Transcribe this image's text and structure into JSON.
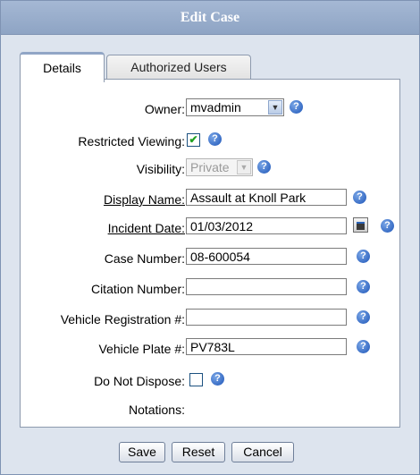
{
  "dialog": {
    "title": "Edit Case"
  },
  "tabs": {
    "details": "Details",
    "authorized_users": "Authorized Users"
  },
  "form": {
    "owner": {
      "label": "Owner:",
      "value": "mvadmin"
    },
    "restricted_viewing": {
      "label": "Restricted Viewing:",
      "checked": true
    },
    "visibility": {
      "label": "Visibility:",
      "value": "Private",
      "disabled": true
    },
    "display_name": {
      "label": "Display Name:",
      "value": "Assault at Knoll Park"
    },
    "incident_date": {
      "label": "Incident Date:",
      "value": "01/03/2012"
    },
    "case_number": {
      "label": "Case Number:",
      "value": "08-600054"
    },
    "citation_number": {
      "label": "Citation Number:",
      "value": ""
    },
    "vehicle_registration": {
      "label": "Vehicle Registration #:",
      "value": ""
    },
    "vehicle_plate": {
      "label": "Vehicle Plate #:",
      "value": "PV783L"
    },
    "do_not_dispose": {
      "label": "Do Not Dispose:",
      "checked": false
    },
    "notations": {
      "label": "Notations:"
    }
  },
  "icons": {
    "help": "?",
    "check": "✔",
    "dropdown": "▼"
  },
  "buttons": {
    "save": "Save",
    "reset": "Reset",
    "cancel": "Cancel"
  },
  "colors": {
    "title_bar": "#8ea4c4",
    "help_icon": "#1d55b8",
    "background": "#dde4ee"
  }
}
